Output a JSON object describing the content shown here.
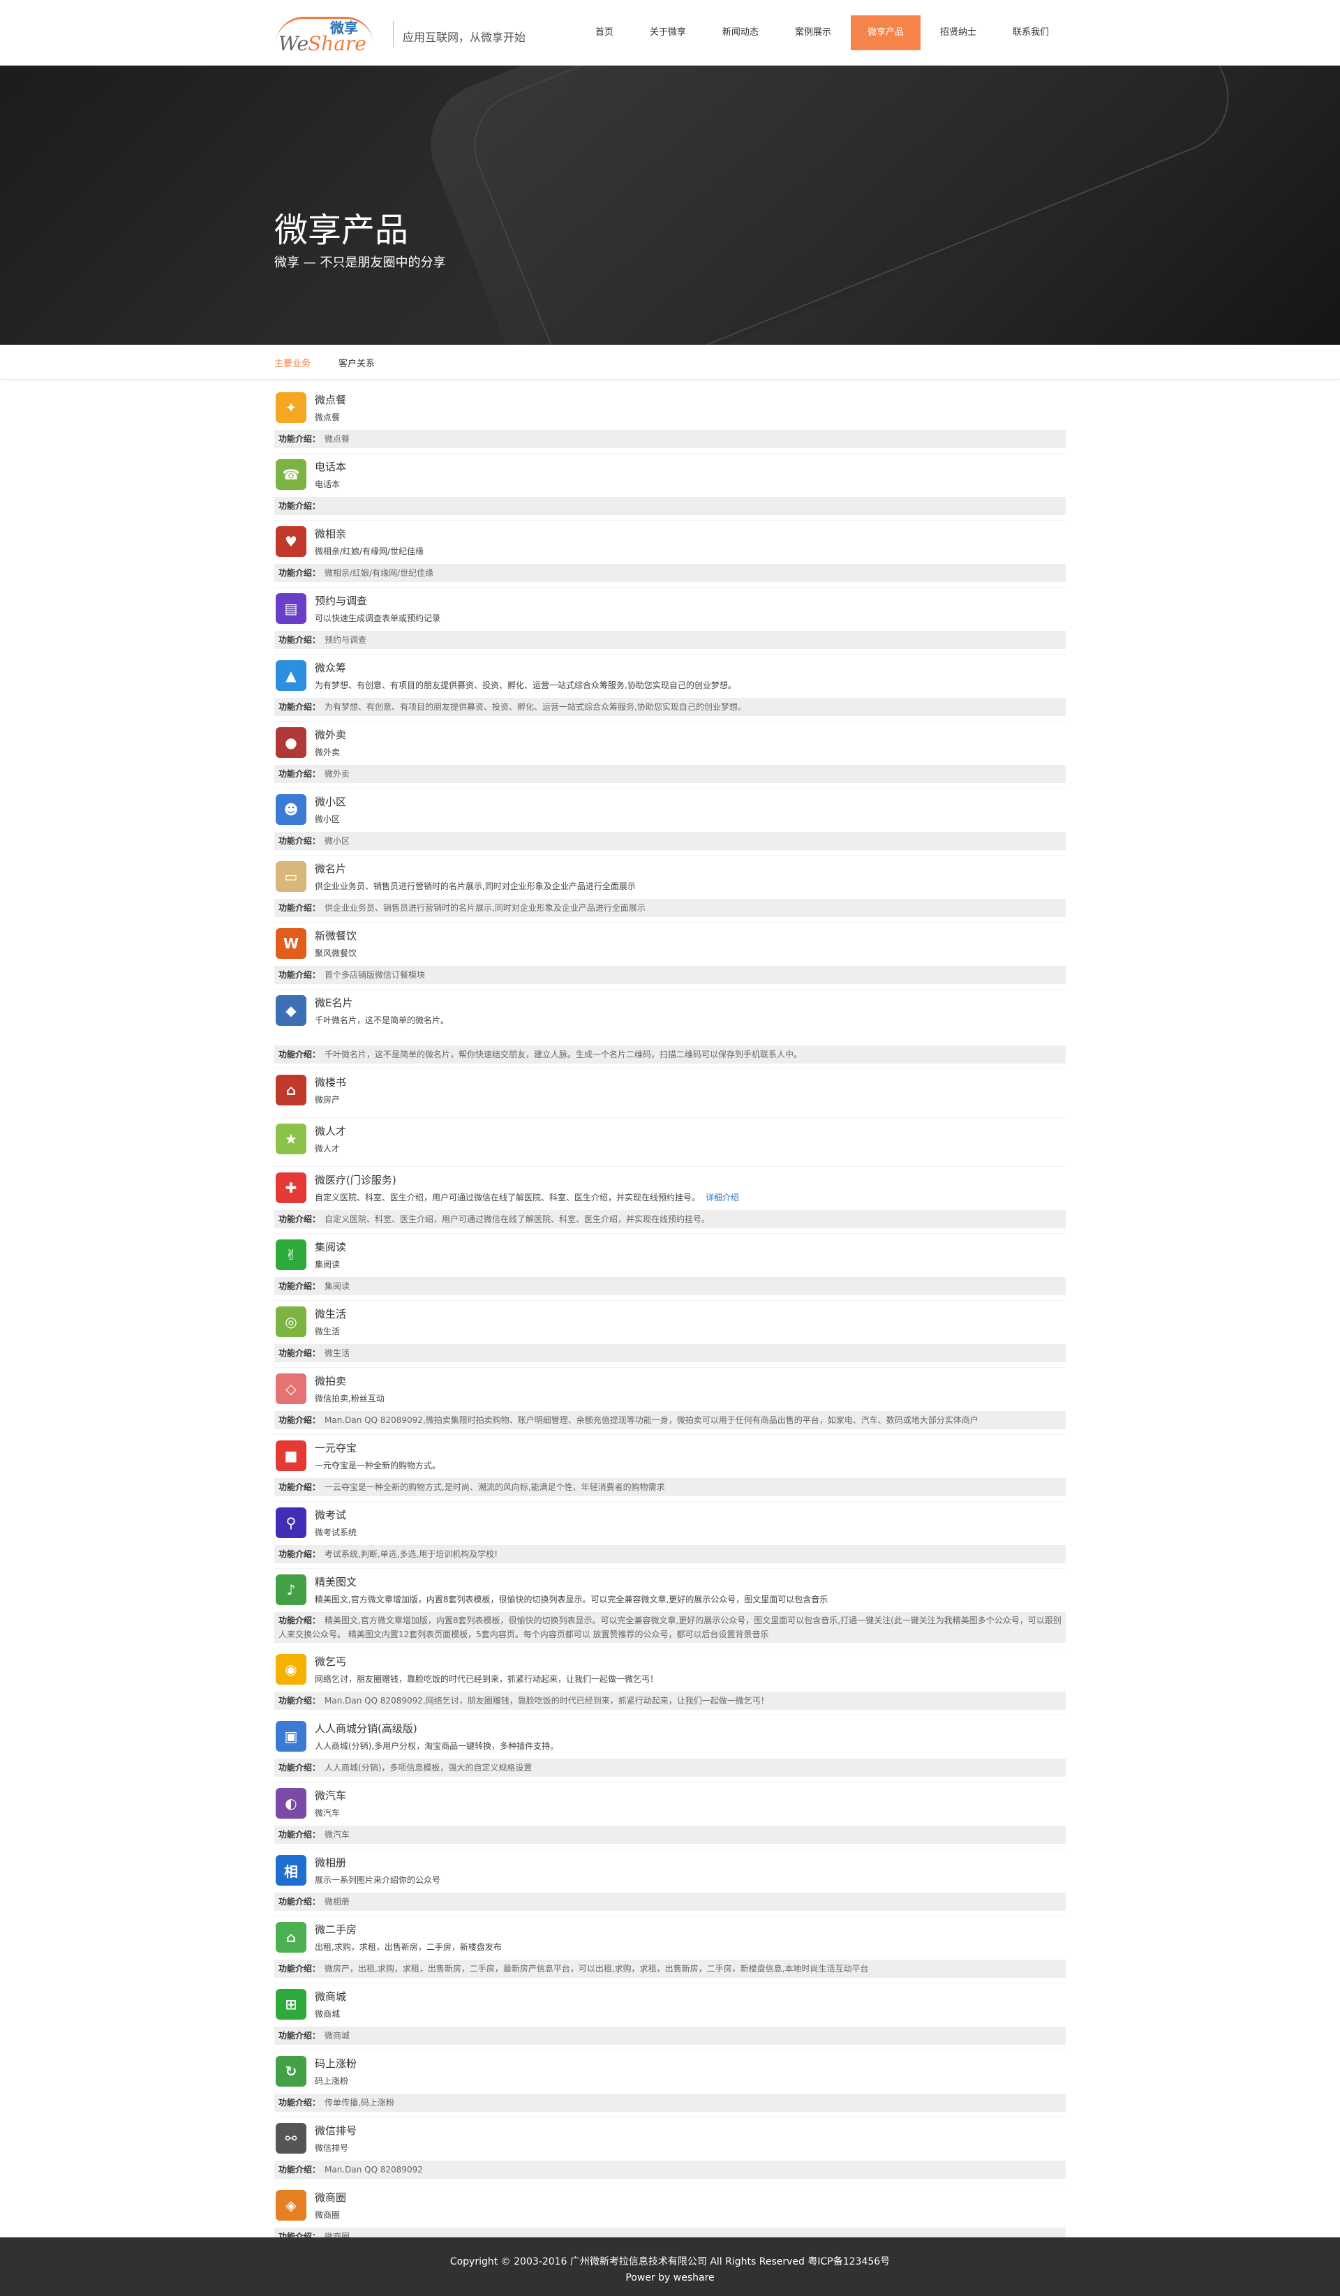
{
  "header": {
    "logo_we": "We",
    "logo_share": "Share",
    "logo_badge": "微享",
    "slogan": "应用互联网，从微享开始",
    "nav": [
      {
        "label": "首页"
      },
      {
        "label": "关于微享"
      },
      {
        "label": "新闻动态"
      },
      {
        "label": "案例展示"
      },
      {
        "label": "微享产品"
      },
      {
        "label": "招贤纳士"
      },
      {
        "label": "联系我们"
      }
    ],
    "active_index": 4
  },
  "banner": {
    "title": "微享产品",
    "subtitle": "微享 — 不只是朋友圈中的分享"
  },
  "tabs": [
    {
      "label": "主要业务"
    },
    {
      "label": "客户关系"
    }
  ],
  "intro_label": "功能介绍：",
  "products": [
    {
      "name": "微点餐",
      "desc": "微点餐",
      "intro": "微点餐",
      "icon": "food-icon",
      "color": "#f5a623"
    },
    {
      "name": "电话本",
      "desc": "电话本",
      "intro": "",
      "icon": "phonebook-icon",
      "color": "#7cb342"
    },
    {
      "name": "微相亲",
      "desc": "微相亲/红娘/有缘网/世纪佳缘",
      "intro": "微相亲/红娘/有缘网/世纪佳缘",
      "icon": "couple-icon",
      "color": "#c0392b"
    },
    {
      "name": "预约与调查",
      "desc": "可以快速生成调查表单或预约记录",
      "intro": "预约与调查",
      "icon": "document-icon",
      "color": "#6a3fc8"
    },
    {
      "name": "微众筹",
      "desc": "为有梦想、有创意、有项目的朋友提供募资、投资、孵化、运营一站式综合众筹服务,协助您实现自己的创业梦想。",
      "intro": "为有梦想、有创意、有项目的朋友提供募资、投资、孵化、运营一站式综合众筹服务,协助您实现自己的创业梦想。",
      "icon": "crowdfund-icon",
      "color": "#2d8fe0"
    },
    {
      "name": "微外卖",
      "desc": "微外卖",
      "intro": "微外卖",
      "icon": "plate-icon",
      "color": "#b13838"
    },
    {
      "name": "微小区",
      "desc": "微小区",
      "intro": "微小区",
      "icon": "people-icon",
      "color": "#3a7bd5"
    },
    {
      "name": "微名片",
      "desc": "供企业业务员、销售员进行营销时的名片展示,同时对企业形象及企业产品进行全面展示",
      "intro": "供企业业务员、销售员进行营销时的名片展示,同时对企业形象及企业产品进行全面展示",
      "icon": "card-icon",
      "color": "#d9b77a"
    },
    {
      "name": "新微餐饮",
      "desc": "聚风微餐饮",
      "intro": "首个多店铺版微信订餐模块",
      "icon": "dining-icon",
      "color": "#e05d1c"
    },
    {
      "name": "微E名片",
      "desc": "千叶微名片，这不是简单的微名片。",
      "intro": "千叶微名片，这不是简单的微名片，帮你快速结交朋友，建立人脉。生成一个名片二维码，扫描二维码可以保存到手机联系人中。",
      "icon": "ecard-icon",
      "color": "#3d6fb6",
      "extra_height": true
    },
    {
      "name": "微楼书",
      "desc": "微房产",
      "intro": "",
      "icon": "house-icon",
      "color": "#c0392b",
      "no_intro": true
    },
    {
      "name": "微人才",
      "desc": "微人才",
      "intro": "",
      "icon": "talent-icon",
      "color": "#8bc34a",
      "no_intro": true
    },
    {
      "name": "微医疗(门诊服务)",
      "desc": "自定义医院、科室、医生介绍，用户可通过微信在线了解医院、科室、医生介绍，并实现在线预约挂号。",
      "link": "详细介绍",
      "intro": "自定义医院、科室、医生介绍，用户可通过微信在线了解医院、科室、医生介绍，并实现在线预约挂号。",
      "icon": "medical-icon",
      "color": "#e53935"
    },
    {
      "name": "集阅读",
      "desc": "集阅读",
      "intro": "集阅读",
      "icon": "victory-icon",
      "color": "#2eaa3c"
    },
    {
      "name": "微生活",
      "desc": "微生活",
      "intro": "微生活",
      "icon": "life-icon",
      "color": "#7cb342"
    },
    {
      "name": "微拍卖",
      "desc": "微信拍卖,粉丝互动",
      "intro": "Man.Dan QQ 82089092,微拍卖集限时拍卖购物、账户明细管理、余额充值提现等功能一身，微拍卖可以用于任何有商品出售的平台，如家电、汽车、数码或地大部分实体商户",
      "icon": "auction-icon",
      "color": "#e57373"
    },
    {
      "name": "一元夺宝",
      "desc": "一元夺宝是一种全新的购物方式。",
      "intro": "一云夺宝是一种全新的购物方式,是时尚、潮流的风向标,能满足个性、年轻消费者的购物需求",
      "icon": "treasure-icon",
      "color": "#e53935"
    },
    {
      "name": "微考试",
      "desc": "微考试系统",
      "intro": "考试系统,判断,单选,多选,用于培训机构及学校!",
      "icon": "exam-icon",
      "color": "#3f2fb8"
    },
    {
      "name": "精美图文",
      "desc": "精美图文,官方微文章增加版，内置8套列表模板，很愉快的切换列表显示。可以完全兼容微文章,更好的展示公众号，图文里面可以包含音乐",
      "intro": "精美图文,官方微文章增加版，内置8套列表模板，很愉快的切换列表显示。可以完全兼容微文章,更好的展示公众号，图文里面可以包含音乐,打通一键关注(此一键关注为我精美图多个公众号，可以跟别人来交换公众号。 精美图文内置12套列表页面模板，5套内容页。每个内容页都可以 放置赞推荐的公众号，都可以后台设置背景音乐",
      "icon": "speaker-icon",
      "color": "#43a047",
      "tall_intro": true
    },
    {
      "name": "微乞丐",
      "desc": "网络乞讨，朋友圈赠钱，靠脸吃饭的时代已经到来，抓紧行动起来，让我们一起做一微乞丐！",
      "intro": "Man.Dan QQ 82089092,网络乞讨，朋友圈赠钱，靠脸吃饭的时代已经到来，抓紧行动起来，让我们一起做一微乞丐！",
      "icon": "beggar-icon",
      "color": "#f5b000"
    },
    {
      "name": "人人商城分销(高级版)",
      "desc": "人人商城(分销),多用户分权，淘宝商品一键转换，多种插件支持。",
      "intro": "人人商城(分销)，多项信息模板，强大的自定义规格设置",
      "icon": "mall-icon",
      "color": "#3a7bd5"
    },
    {
      "name": "微汽车",
      "desc": "微汽车",
      "intro": "微汽车",
      "icon": "car-icon",
      "color": "#7b4aa6"
    },
    {
      "name": "微相册",
      "desc": "展示一系列图片来介绍你的公众号",
      "intro": "微相册",
      "icon": "album-icon",
      "color": "#1e6fd0"
    },
    {
      "name": "微二手房",
      "desc": "出租,求购，求租，出售新房，二手房，新楼盘发布",
      "intro": "微房产，出租,求购，求租，出售新房，二手房，最新房产信息平台，可以出租,求购，求租，出售新房，二手房，新楼盘信息,本地时尚生活互动平台",
      "icon": "secondhand-icon",
      "color": "#4caf50"
    },
    {
      "name": "微商城",
      "desc": "微商城",
      "intro": "微商城",
      "icon": "cart-icon",
      "color": "#2eaa3c"
    },
    {
      "name": "码上涨粉",
      "desc": "码上涨粉",
      "intro": "传单传播,码上涨粉",
      "icon": "refresh-icon",
      "color": "#43a047"
    },
    {
      "name": "微信排号",
      "desc": "微信排号",
      "intro": "Man.Dan QQ 82089092",
      "icon": "queue-icon",
      "color": "#555555"
    },
    {
      "name": "微商圈",
      "desc": "微商圈",
      "intro": "微商圈",
      "icon": "circle-icon",
      "color": "#e67e22"
    }
  ],
  "footer": {
    "copyright": "Copyright © 2003-2016 广州微新考拉信息技术有限公司 All Rights Reserved    粤ICP备123456号",
    "powered": "Power by weshare"
  }
}
